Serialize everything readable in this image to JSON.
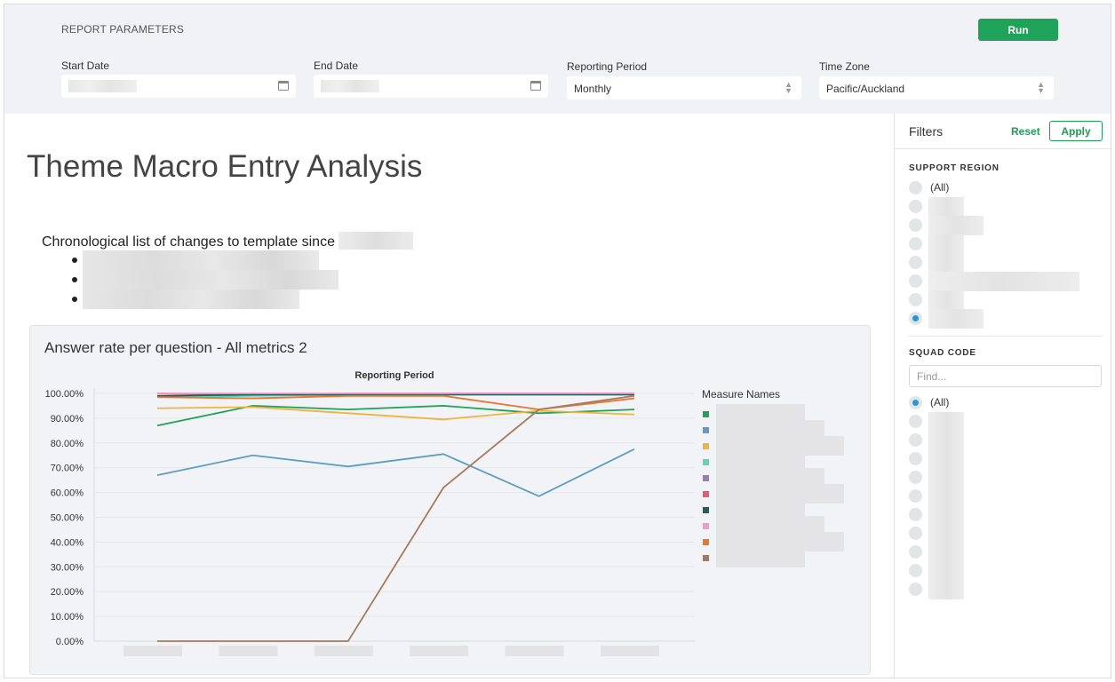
{
  "params": {
    "title": "REPORT PARAMETERS",
    "run_label": "Run",
    "start_date_label": "Start Date",
    "end_date_label": "End Date",
    "reporting_period_label": "Reporting Period",
    "reporting_period_value": "Monthly",
    "time_zone_label": "Time Zone",
    "time_zone_value": "Pacific/Auckland"
  },
  "main": {
    "title": "Theme Macro Entry Analysis",
    "intro": "Chronological list of changes to template since"
  },
  "chart_card": {
    "title": "Answer rate per question - All metrics 2"
  },
  "chart_data": {
    "type": "line",
    "title": "Reporting Period",
    "xlabel": "",
    "ylabel": "",
    "ylim": [
      0,
      100
    ],
    "y_ticks": [
      "0.00%",
      "10.00%",
      "20.00%",
      "30.00%",
      "40.00%",
      "50.00%",
      "60.00%",
      "70.00%",
      "80.00%",
      "90.00%",
      "100.00%"
    ],
    "x_points": 6,
    "legend_title": "Measure Names",
    "legend_placement": "right",
    "grid": true,
    "series": [
      {
        "color": "#1fa35b",
        "values": [
          87,
          95,
          93.5,
          95,
          92,
          93.5
        ]
      },
      {
        "color": "#5b9ec2",
        "values": [
          67,
          75,
          70.5,
          75.5,
          58.5,
          77.5
        ]
      },
      {
        "color": "#f0b43c",
        "values": [
          94,
          94.5,
          92,
          89.5,
          93,
          91.5
        ]
      },
      {
        "color": "#5fd6b8",
        "values": [
          98.5,
          99,
          99.5,
          99.5,
          99.5,
          99.5
        ]
      },
      {
        "color": "#9b7bb8",
        "values": [
          99,
          99.5,
          99.5,
          100,
          100,
          100
        ]
      },
      {
        "color": "#e85a6e",
        "values": [
          100,
          99.5,
          100,
          100,
          100,
          100
        ]
      },
      {
        "color": "#1e6060",
        "values": [
          99,
          99.5,
          99.5,
          99.5,
          99.5,
          99.5
        ]
      },
      {
        "color": "#f29ac9",
        "values": [
          100,
          100,
          100,
          100,
          100,
          100
        ]
      },
      {
        "color": "#e8762c",
        "values": [
          98.5,
          98,
          99,
          99,
          93.5,
          98
        ]
      },
      {
        "color": "#a77a5c",
        "values": [
          0,
          0,
          0,
          62,
          93.5,
          99
        ]
      }
    ]
  },
  "filters": {
    "title": "Filters",
    "reset_label": "Reset",
    "apply_label": "Apply",
    "support_region_title": "SUPPORT REGION",
    "support_region_all": "(All)",
    "squad_code_title": "SQUAD CODE",
    "find_placeholder": "Find...",
    "squad_code_all": "(All)"
  }
}
